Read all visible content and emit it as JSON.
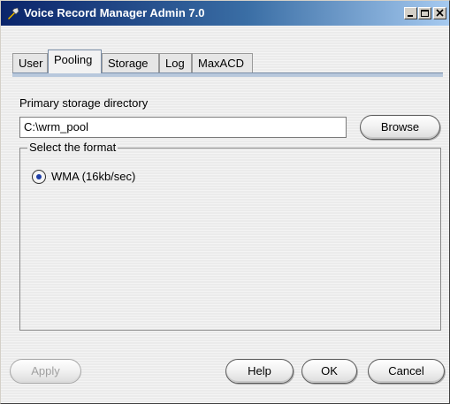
{
  "window": {
    "title": "Voice Record Manager Admin 7.0"
  },
  "tabs": [
    {
      "label": "User",
      "active": false
    },
    {
      "label": "Pooling",
      "active": true
    },
    {
      "label": "Storage",
      "active": false
    },
    {
      "label": "Log",
      "active": false
    },
    {
      "label": "MaxACD",
      "active": false
    }
  ],
  "pooling": {
    "directory_label": "Primary storage directory",
    "directory_value": "C:\\wrm_pool",
    "browse_label": "Browse",
    "format_group_label": "Select the format",
    "format_options": [
      {
        "label": "WMA (16kb/sec)",
        "selected": true
      }
    ]
  },
  "buttons": {
    "apply": "Apply",
    "help": "Help",
    "ok": "OK",
    "cancel": "Cancel"
  },
  "colors": {
    "titlebar_start": "#0a246a",
    "titlebar_end": "#a6caf0",
    "radio_dot": "#1f3fa8"
  }
}
